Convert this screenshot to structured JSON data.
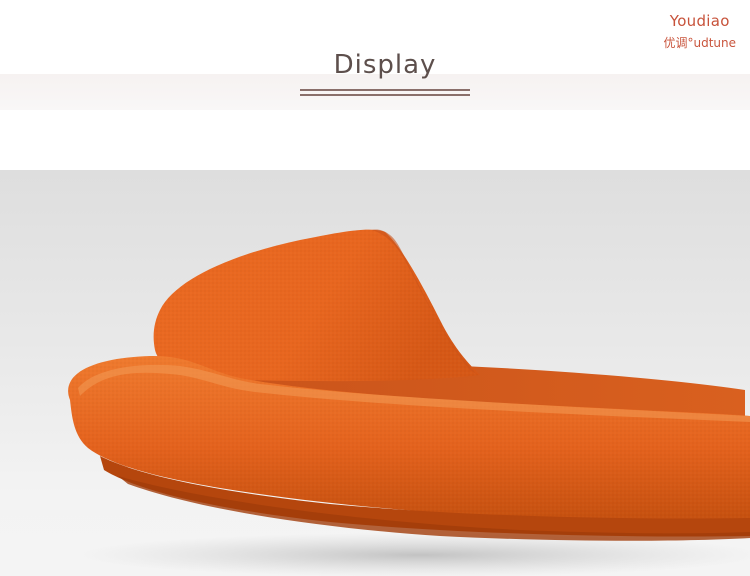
{
  "brand": {
    "name": "Youdiao",
    "subline": "优调°udtune"
  },
  "section": {
    "title": "Display"
  },
  "photo": {
    "subject": "orange-slide-sandal",
    "colors": {
      "sandal": "#e8661f",
      "sandal_shadow": "#b9490f",
      "sandal_highlight": "#f08a3e",
      "background": "#e6e6e6"
    }
  }
}
